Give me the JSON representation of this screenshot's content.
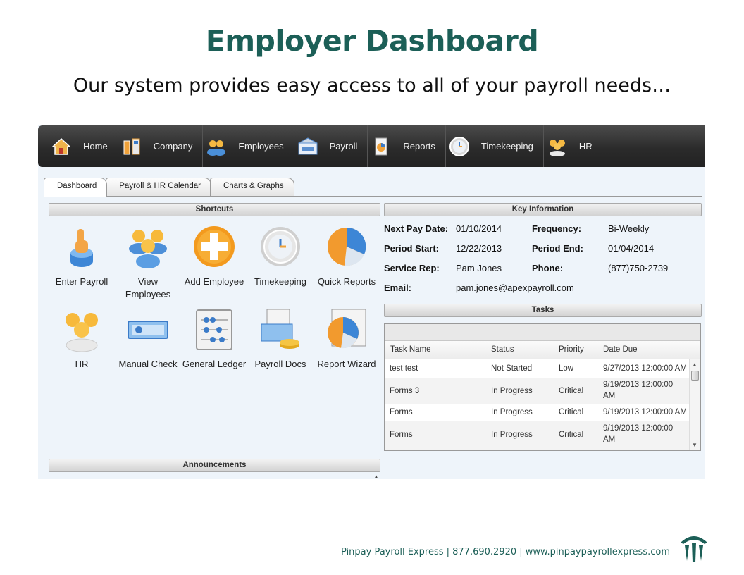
{
  "slide": {
    "title": "Employer Dashboard",
    "subtitle": "Our system provides easy access to all of your payroll needs…",
    "footer": "Pinpay Payroll Express | 877.690.2920 | www.pinpaypayrollexpress.com"
  },
  "nav": {
    "items": [
      {
        "label": "Home",
        "icon": "home-icon"
      },
      {
        "label": "Company",
        "icon": "company-icon"
      },
      {
        "label": "Employees",
        "icon": "employees-icon"
      },
      {
        "label": "Payroll",
        "icon": "payroll-icon"
      },
      {
        "label": "Reports",
        "icon": "reports-icon"
      },
      {
        "label": "Timekeeping",
        "icon": "clock-icon"
      },
      {
        "label": "HR",
        "icon": "hr-icon"
      }
    ]
  },
  "tabs": [
    "Dashboard",
    "Payroll & HR Calendar",
    "Charts & Graphs"
  ],
  "shortcuts": {
    "title": "Shortcuts",
    "items": [
      {
        "label": "Enter Payroll",
        "icon": "hand-pointer-icon"
      },
      {
        "label": "View Employees",
        "icon": "people-group-icon"
      },
      {
        "label": "Add Employee",
        "icon": "add-plus-icon"
      },
      {
        "label": "Timekeeping",
        "icon": "clock-icon"
      },
      {
        "label": "Quick Reports",
        "icon": "pie-chart-icon"
      },
      {
        "label": "HR",
        "icon": "people-group-icon"
      },
      {
        "label": "Manual Check",
        "icon": "check-icon"
      },
      {
        "label": "General Ledger",
        "icon": "abacus-icon"
      },
      {
        "label": "Payroll Docs",
        "icon": "documents-icon"
      },
      {
        "label": "Report Wizard",
        "icon": "report-wizard-icon"
      }
    ]
  },
  "key_info": {
    "title": "Key Information",
    "next_pay_date_label": "Next Pay Date:",
    "next_pay_date": "01/10/2014",
    "frequency_label": "Frequency:",
    "frequency": "Bi-Weekly",
    "period_start_label": "Period Start:",
    "period_start": "12/22/2013",
    "period_end_label": "Period End:",
    "period_end": "01/04/2014",
    "service_rep_label": "Service Rep:",
    "service_rep": "Pam Jones",
    "phone_label": "Phone:",
    "phone": "(877)750-2739",
    "email_label": "Email:",
    "email": "pam.jones@apexpayroll.com"
  },
  "tasks": {
    "title": "Tasks",
    "columns": [
      "Task Name",
      "Status",
      "Priority",
      "Date Due"
    ],
    "rows": [
      {
        "name": "test test",
        "status": "Not Started",
        "priority": "Low",
        "due_1": "9/27/2013 12:00:00 AM",
        "due_2": ""
      },
      {
        "name": "Forms 3",
        "status": "In Progress",
        "priority": "Critical",
        "due_1": "9/19/2013 12:00:00",
        "due_2": "AM"
      },
      {
        "name": "Forms",
        "status": "In Progress",
        "priority": "Critical",
        "due_1": "9/19/2013 12:00:00 AM",
        "due_2": ""
      },
      {
        "name": "Forms",
        "status": "In Progress",
        "priority": "Critical",
        "due_1": "9/19/2013 12:00:00",
        "due_2": "AM"
      }
    ]
  },
  "announcements": {
    "title": "Announcements"
  },
  "colors": {
    "brand": "#1c5f57",
    "navbar": "#2b2b2b",
    "panel_bg": "#eef4fa"
  }
}
